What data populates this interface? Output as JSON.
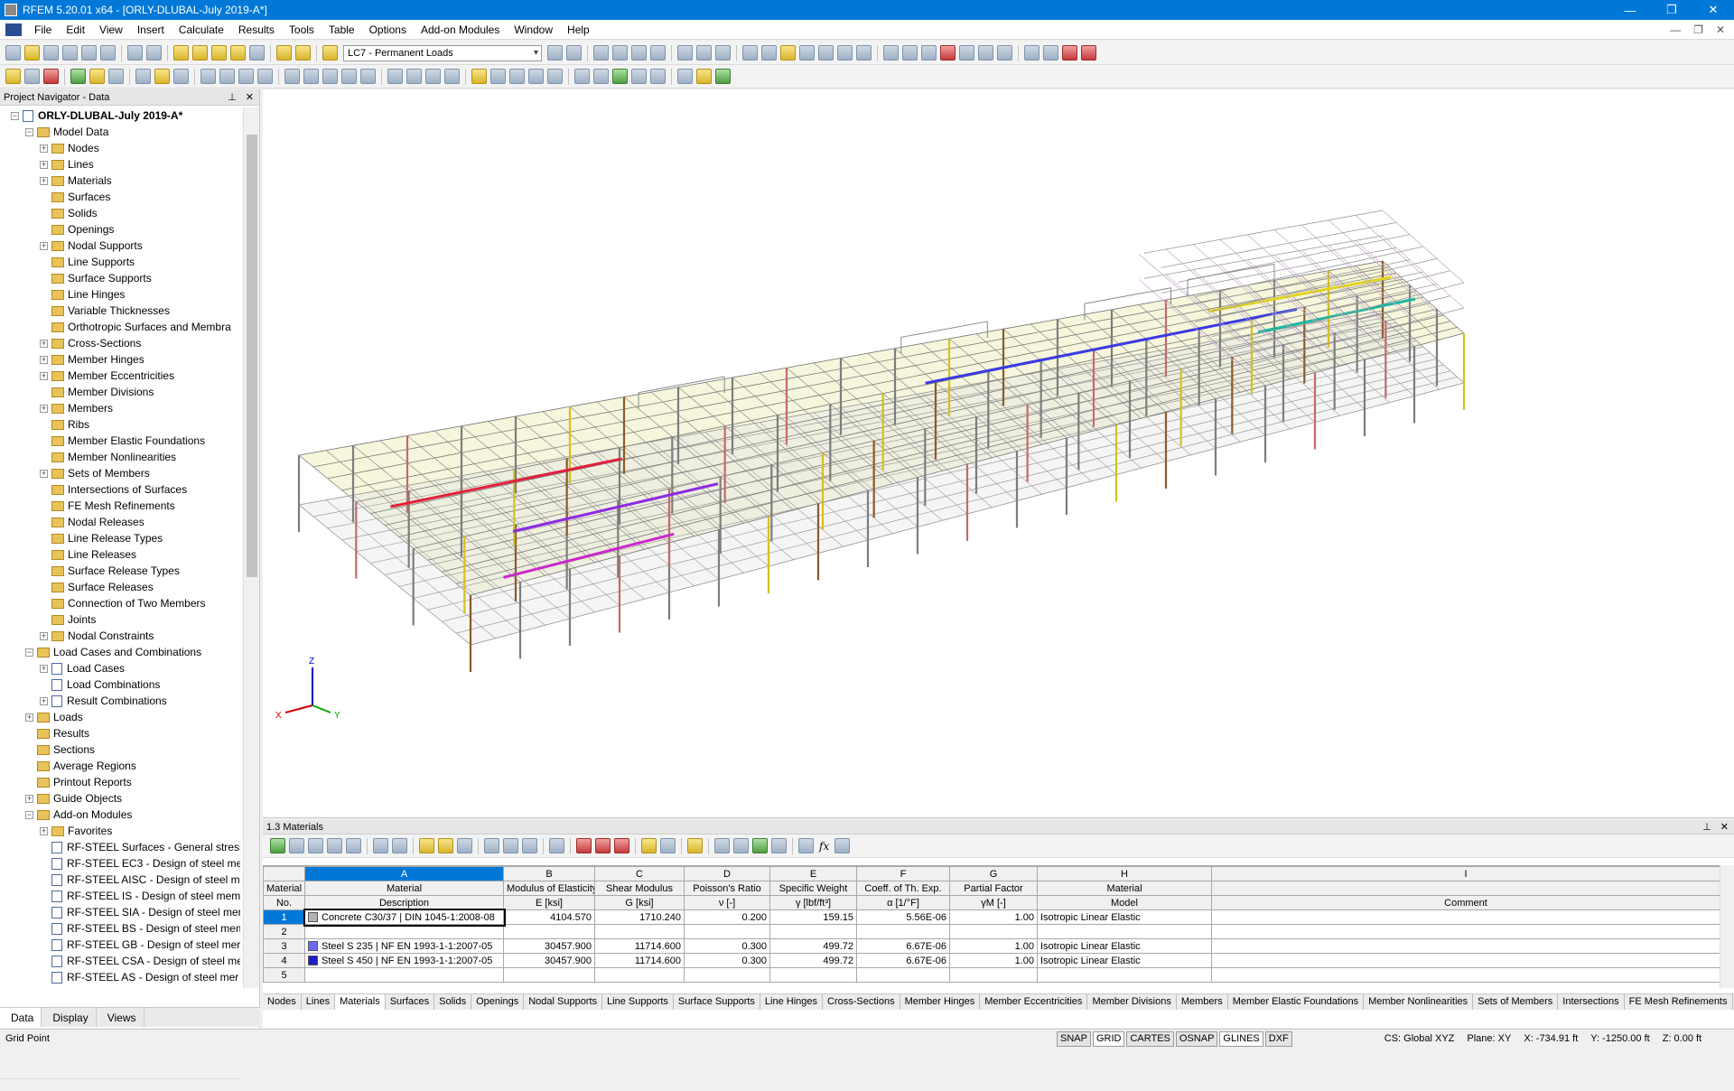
{
  "window": {
    "title": "RFEM 5.20.01 x64 - [ORLY-DLUBAL-July 2019-A*]",
    "minimize": "—",
    "restore": "❐",
    "close": "✕"
  },
  "menu": [
    "File",
    "Edit",
    "View",
    "Insert",
    "Calculate",
    "Results",
    "Tools",
    "Table",
    "Options",
    "Add-on Modules",
    "Window",
    "Help"
  ],
  "toolbar": {
    "load_case": "LC7 - Permanent Loads"
  },
  "navigator": {
    "title": "Project Navigator - Data",
    "project": "ORLY-DLUBAL-July 2019-A*",
    "items": [
      {
        "label": "Model Data",
        "level": 1,
        "exp": "−",
        "icon": "folder"
      },
      {
        "label": "Nodes",
        "level": 2,
        "exp": "+",
        "icon": "folder"
      },
      {
        "label": "Lines",
        "level": 2,
        "exp": "+",
        "icon": "folder"
      },
      {
        "label": "Materials",
        "level": 2,
        "exp": "+",
        "icon": "folder"
      },
      {
        "label": "Surfaces",
        "level": 2,
        "exp": "",
        "icon": "folder"
      },
      {
        "label": "Solids",
        "level": 2,
        "exp": "",
        "icon": "folder"
      },
      {
        "label": "Openings",
        "level": 2,
        "exp": "",
        "icon": "folder"
      },
      {
        "label": "Nodal Supports",
        "level": 2,
        "exp": "+",
        "icon": "folder"
      },
      {
        "label": "Line Supports",
        "level": 2,
        "exp": "",
        "icon": "folder"
      },
      {
        "label": "Surface Supports",
        "level": 2,
        "exp": "",
        "icon": "folder"
      },
      {
        "label": "Line Hinges",
        "level": 2,
        "exp": "",
        "icon": "folder"
      },
      {
        "label": "Variable Thicknesses",
        "level": 2,
        "exp": "",
        "icon": "folder"
      },
      {
        "label": "Orthotropic Surfaces and Membra",
        "level": 2,
        "exp": "",
        "icon": "folder"
      },
      {
        "label": "Cross-Sections",
        "level": 2,
        "exp": "+",
        "icon": "folder"
      },
      {
        "label": "Member Hinges",
        "level": 2,
        "exp": "+",
        "icon": "folder"
      },
      {
        "label": "Member Eccentricities",
        "level": 2,
        "exp": "+",
        "icon": "folder"
      },
      {
        "label": "Member Divisions",
        "level": 2,
        "exp": "",
        "icon": "folder"
      },
      {
        "label": "Members",
        "level": 2,
        "exp": "+",
        "icon": "folder"
      },
      {
        "label": "Ribs",
        "level": 2,
        "exp": "",
        "icon": "folder"
      },
      {
        "label": "Member Elastic Foundations",
        "level": 2,
        "exp": "",
        "icon": "folder"
      },
      {
        "label": "Member Nonlinearities",
        "level": 2,
        "exp": "",
        "icon": "folder"
      },
      {
        "label": "Sets of Members",
        "level": 2,
        "exp": "+",
        "icon": "folder"
      },
      {
        "label": "Intersections of Surfaces",
        "level": 2,
        "exp": "",
        "icon": "folder"
      },
      {
        "label": "FE Mesh Refinements",
        "level": 2,
        "exp": "",
        "icon": "folder"
      },
      {
        "label": "Nodal Releases",
        "level": 2,
        "exp": "",
        "icon": "folder"
      },
      {
        "label": "Line Release Types",
        "level": 2,
        "exp": "",
        "icon": "folder"
      },
      {
        "label": "Line Releases",
        "level": 2,
        "exp": "",
        "icon": "folder"
      },
      {
        "label": "Surface Release Types",
        "level": 2,
        "exp": "",
        "icon": "folder"
      },
      {
        "label": "Surface Releases",
        "level": 2,
        "exp": "",
        "icon": "folder"
      },
      {
        "label": "Connection of Two Members",
        "level": 2,
        "exp": "",
        "icon": "folder"
      },
      {
        "label": "Joints",
        "level": 2,
        "exp": "",
        "icon": "folder"
      },
      {
        "label": "Nodal Constraints",
        "level": 2,
        "exp": "+",
        "icon": "folder"
      },
      {
        "label": "Load Cases and Combinations",
        "level": 1,
        "exp": "−",
        "icon": "folder"
      },
      {
        "label": "Load Cases",
        "level": 2,
        "exp": "+",
        "icon": "doc"
      },
      {
        "label": "Load Combinations",
        "level": 2,
        "exp": "",
        "icon": "doc"
      },
      {
        "label": "Result Combinations",
        "level": 2,
        "exp": "+",
        "icon": "doc"
      },
      {
        "label": "Loads",
        "level": 1,
        "exp": "+",
        "icon": "folder"
      },
      {
        "label": "Results",
        "level": 1,
        "exp": "",
        "icon": "folder"
      },
      {
        "label": "Sections",
        "level": 1,
        "exp": "",
        "icon": "folder"
      },
      {
        "label": "Average Regions",
        "level": 1,
        "exp": "",
        "icon": "folder"
      },
      {
        "label": "Printout Reports",
        "level": 1,
        "exp": "",
        "icon": "folder"
      },
      {
        "label": "Guide Objects",
        "level": 1,
        "exp": "+",
        "icon": "folder"
      },
      {
        "label": "Add-on Modules",
        "level": 1,
        "exp": "−",
        "icon": "folder"
      },
      {
        "label": "Favorites",
        "level": 2,
        "exp": "+",
        "icon": "folder"
      },
      {
        "label": "RF-STEEL Surfaces - General stress",
        "level": 2,
        "exp": "",
        "icon": "doc"
      },
      {
        "label": "RF-STEEL EC3 - Design of steel me",
        "level": 2,
        "exp": "",
        "icon": "doc"
      },
      {
        "label": "RF-STEEL AISC - Design of steel m",
        "level": 2,
        "exp": "",
        "icon": "doc"
      },
      {
        "label": "RF-STEEL IS - Design of steel mem",
        "level": 2,
        "exp": "",
        "icon": "doc"
      },
      {
        "label": "RF-STEEL SIA - Design of steel mer",
        "level": 2,
        "exp": "",
        "icon": "doc"
      },
      {
        "label": "RF-STEEL BS - Design of steel mem",
        "level": 2,
        "exp": "",
        "icon": "doc"
      },
      {
        "label": "RF-STEEL GB - Design of steel mer",
        "level": 2,
        "exp": "",
        "icon": "doc"
      },
      {
        "label": "RF-STEEL CSA - Design of steel me",
        "level": 2,
        "exp": "",
        "icon": "doc"
      },
      {
        "label": "RF-STEEL AS - Design of steel mer",
        "level": 2,
        "exp": "",
        "icon": "doc"
      }
    ],
    "tabs": [
      "Data",
      "Display",
      "Views"
    ]
  },
  "viewport": {
    "axis_z": "Z",
    "axis_x": "X",
    "axis_y": "Y"
  },
  "table": {
    "title": "1.3 Materials",
    "col_letters": [
      "A",
      "B",
      "C",
      "D",
      "E",
      "F",
      "G",
      "H",
      "I"
    ],
    "header1": [
      "Material",
      "Material",
      "Modulus of Elasticity",
      "Shear Modulus",
      "Poisson's Ratio",
      "Specific Weight",
      "Coeff. of Th. Exp.",
      "Partial Factor",
      "Material",
      ""
    ],
    "header2": [
      "No.",
      "Description",
      "E [ksi]",
      "G [ksi]",
      "ν [-]",
      "γ [lbf/ft³]",
      "α [1/°F]",
      "γM [-]",
      "Model",
      "Comment"
    ],
    "rows": [
      {
        "no": "1",
        "desc": "Concrete C30/37 | DIN 1045-1:2008-08",
        "color": "#b3b3b3",
        "E": "4104.570",
        "G": "1710.240",
        "nu": "0.200",
        "gamma": "159.15",
        "alpha": "5.56E-06",
        "gm": "1.00",
        "model": "Isotropic Linear Elastic",
        "comment": ""
      },
      {
        "no": "2",
        "desc": "",
        "color": "",
        "E": "",
        "G": "",
        "nu": "",
        "gamma": "",
        "alpha": "",
        "gm": "",
        "model": "",
        "comment": ""
      },
      {
        "no": "3",
        "desc": "Steel S 235 | NF EN 1993-1-1:2007-05",
        "color": "#6a6af0",
        "E": "30457.900",
        "G": "11714.600",
        "nu": "0.300",
        "gamma": "499.72",
        "alpha": "6.67E-06",
        "gm": "1.00",
        "model": "Isotropic Linear Elastic",
        "comment": ""
      },
      {
        "no": "4",
        "desc": "Steel S 450 | NF EN 1993-1-1:2007-05",
        "color": "#1c1cc8",
        "E": "30457.900",
        "G": "11714.600",
        "nu": "0.300",
        "gamma": "499.72",
        "alpha": "6.67E-06",
        "gm": "1.00",
        "model": "Isotropic Linear Elastic",
        "comment": ""
      },
      {
        "no": "5",
        "desc": "",
        "color": "",
        "E": "",
        "G": "",
        "nu": "",
        "gamma": "",
        "alpha": "",
        "gm": "",
        "model": "",
        "comment": ""
      }
    ],
    "sheet_tabs": [
      "Nodes",
      "Lines",
      "Materials",
      "Surfaces",
      "Solids",
      "Openings",
      "Nodal Supports",
      "Line Supports",
      "Surface Supports",
      "Line Hinges",
      "Cross-Sections",
      "Member Hinges",
      "Member Eccentricities",
      "Member Divisions",
      "Members",
      "Member Elastic Foundations",
      "Member Nonlinearities",
      "Sets of Members",
      "Intersections",
      "FE Mesh Refinements"
    ],
    "active_tab": "Materials"
  },
  "status": {
    "left": "Grid Point",
    "toggles": [
      "SNAP",
      "GRID",
      "CARTES",
      "OSNAP",
      "GLINES",
      "DXF"
    ],
    "cs": "CS: Global XYZ",
    "plane": "Plane: XY",
    "x": "X:  -734.91 ft",
    "y": "Y:  -1250.00 ft",
    "z": "Z:  0.00 ft"
  }
}
